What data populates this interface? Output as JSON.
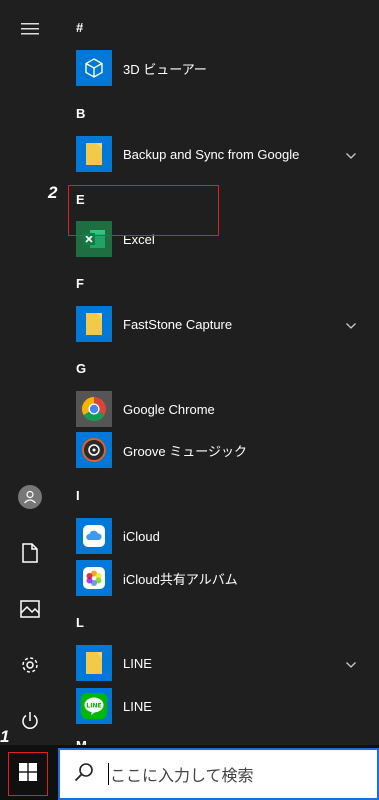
{
  "rail": {
    "items": [
      "menu",
      "user",
      "documents",
      "pictures",
      "settings",
      "power"
    ]
  },
  "sections": {
    "hash": "#",
    "b": "B",
    "e": "E",
    "f": "F",
    "g": "G",
    "i": "I",
    "l": "L",
    "m": "M"
  },
  "apps": {
    "viewer3d": "3D ビューアー",
    "backup": "Backup and Sync from Google",
    "excel": "Excel",
    "faststone": "FastStone Capture",
    "chrome": "Google Chrome",
    "groove": "Groove ミュージック",
    "icloud": "iCloud",
    "icloud_photos": "iCloud共有アルバム",
    "line_folder": "LINE",
    "line": "LINE"
  },
  "callouts": {
    "one": "1",
    "two": "2"
  },
  "search": {
    "placeholder": "ここに入力して検索"
  },
  "colors": {
    "accent_blue": "#0078d7",
    "highlight_red": "#e02020",
    "excel_green": "#1d6f42",
    "line_green": "#00b900"
  }
}
